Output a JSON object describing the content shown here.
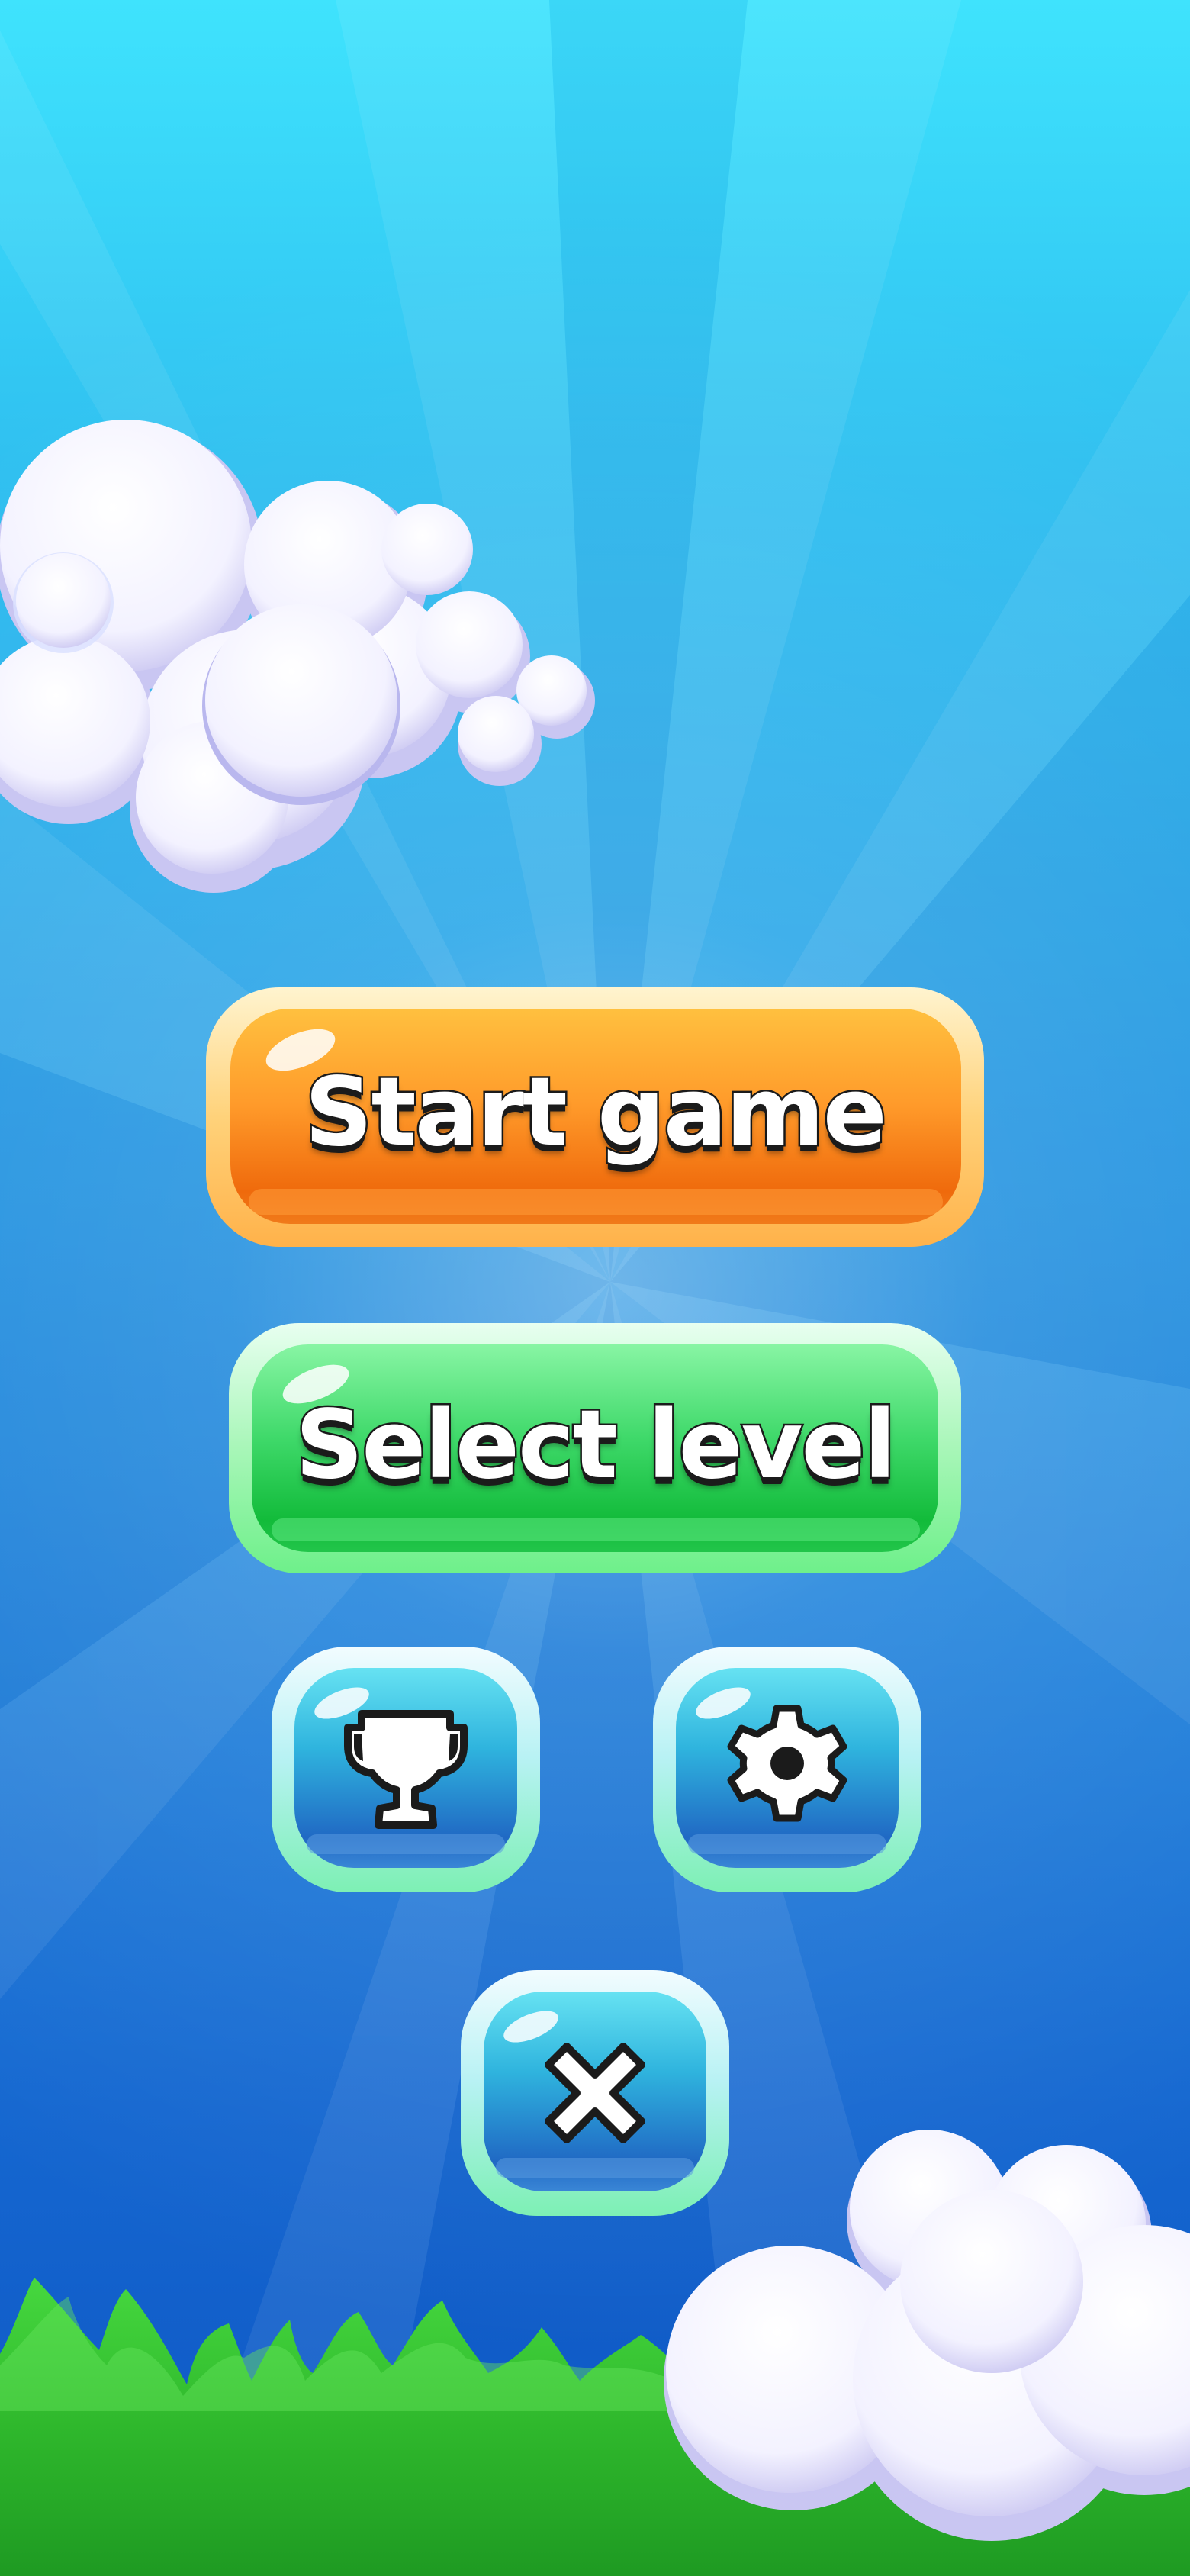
{
  "menu": {
    "start_label": "Start game",
    "select_label": "Select level"
  },
  "icon_buttons": {
    "trophy": "trophy-icon",
    "settings": "gear-icon",
    "close": "close-icon"
  },
  "colors": {
    "sky_top": "#3fe3fd",
    "sky_bottom": "#0e56c4",
    "start_button": "#f98a1c",
    "select_button": "#2bd45a",
    "icon_button": "#3aa8e0",
    "grass": "#3ec83a",
    "label_outline": "#1b1b1b"
  }
}
